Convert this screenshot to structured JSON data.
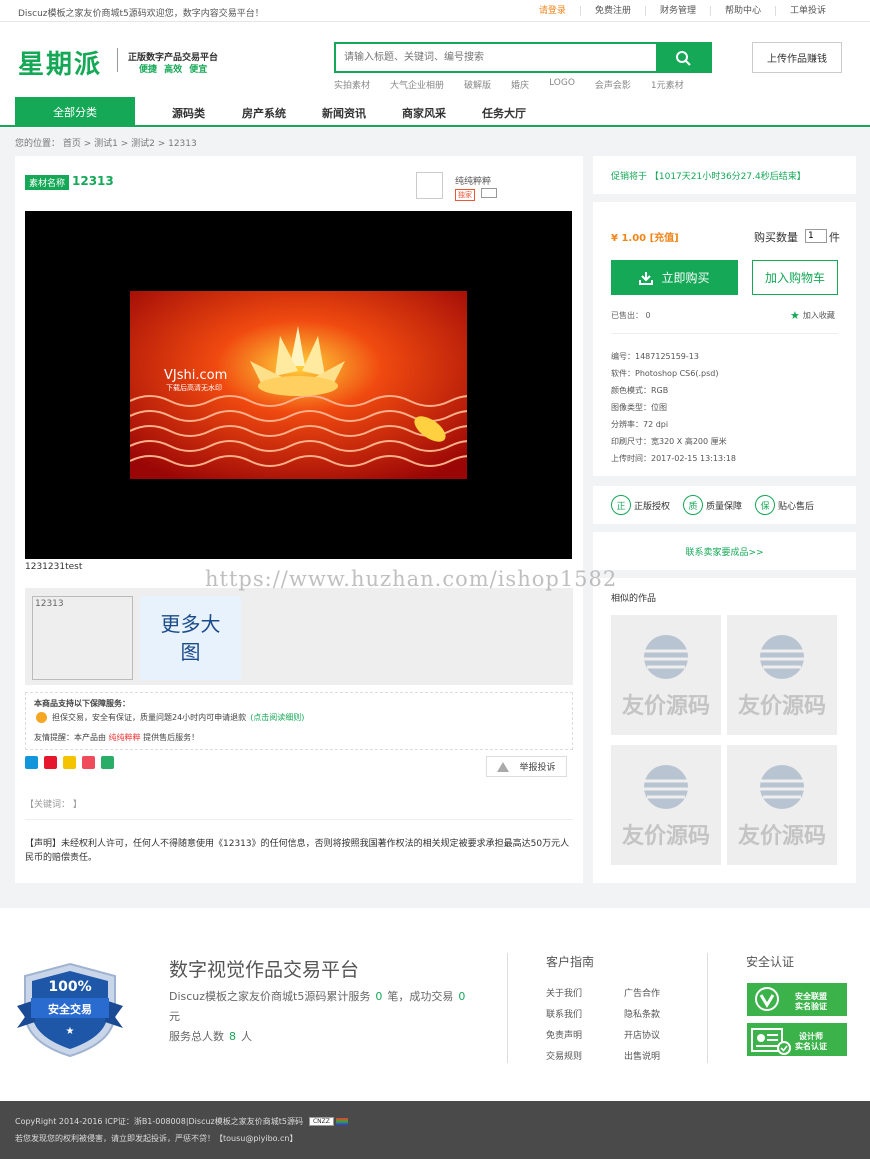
{
  "topbar": {
    "welcome": "Discuz模板之家友价商城t5源码欢迎您，数字内容交易平台！",
    "links": [
      "请登录",
      "免费注册",
      "财务管理",
      "帮助中心",
      "工单投诉"
    ]
  },
  "header": {
    "logo": "星期派",
    "slogan_main": "正版数字产品交易平台",
    "slogan_sub": "便捷 高效 便宜",
    "search_placeholder": "请输入标题、关键词、编号搜索",
    "hot_words": [
      "实拍素材",
      "大气企业相册",
      "破解版",
      "婚庆",
      "LOGO",
      "会声会影",
      "1元素材"
    ],
    "upload_label": "上传作品赚钱"
  },
  "nav": {
    "all": "全部分类",
    "items": [
      "源码类",
      "房产系统",
      "新闻资讯",
      "商家风采",
      "任务大厅"
    ]
  },
  "breadcrumb": "您的位置： 首页 > 测试1 > 测试2 > 12313",
  "product": {
    "tag": "素材名称",
    "title": "12313",
    "seller_name": "纯纯粹粹",
    "seller_badge": "独家",
    "preview_brand": "VJshi.com",
    "preview_note": "下载后高清无水印",
    "caption": "1231231test",
    "watermark": "https://www.huzhan.com/ishop1582",
    "thumb_alt": "12313",
    "more_pics": "更多大图",
    "guarantee_title": "本商品支持以下保障服务：",
    "guarantee_text": "担保交易，安全有保证，质量问题24小时内可申请退款",
    "guarantee_link": "(点击阅读细则)",
    "reminder_prefix": "友情提醒：本产品由",
    "reminder_seller": "纯纯粹粹",
    "reminder_suffix": "提供售后服务！",
    "report": "举报投诉",
    "keywords": "【关键词： 】",
    "statement": "【声明】未经权利人许可，任何人不得随意使用《12313》的任何信息，否则将按照我国著作权法的相关规定被要求承担最高达50万元人民币的赔偿责任。"
  },
  "sidebar": {
    "promo": "促销将于 【1017天21小时36分27.4秒后结束】",
    "price": "¥ 1.00 [充值]",
    "qty_label": "购买数量",
    "qty_value": "1",
    "qty_unit": "件",
    "buy": "立即购买",
    "cart": "加入购物车",
    "sold": "已售出： 0",
    "favorite": "加入收藏",
    "specs": [
      "编号：1487125159-13",
      "软件：Photoshop CS6(.psd)",
      "颜色模式：RGB",
      "图像类型：位图",
      "分辨率：72 dpi",
      "印刷尺寸：宽320 X 高200 厘米",
      "上传时间：2017-02-15 13:13:18"
    ],
    "assure": [
      {
        "icon": "正",
        "label": "正版授权"
      },
      {
        "icon": "质",
        "label": "质量保障"
      },
      {
        "icon": "保",
        "label": "贴心售后"
      }
    ],
    "contact": "联系卖家要成品>>",
    "similar_title": "相似的作品",
    "similar_placeholder": "友价源码"
  },
  "footer": {
    "shield_pct": "100%",
    "shield_text": "安全交易",
    "title": "数字视觉作品交易平台",
    "stats_a": "Discuz模板之家友价商城t5源码累计服务",
    "orders": "0",
    "stats_b": "笔，成功交易",
    "amount": "0",
    "stats_c": "元",
    "users_label": "服务总人数",
    "users": "8",
    "users_unit": "人",
    "guide_title": "客户指南",
    "guide_links": [
      "关于我们",
      "广告合作",
      "联系我们",
      "隐私条款",
      "免责声明",
      "开店协议",
      "交易规则",
      "出售说明"
    ],
    "security_title": "安全认证",
    "cert1": [
      "安全联盟",
      "实名验证"
    ],
    "cert2": [
      "设计师",
      "实名认证"
    ]
  },
  "bottom": {
    "line1": "CopyRight 2014-2016 ICP证：浙B1-008008|Discuz模板之家友价商城t5源码",
    "cnzz": "CNZZ",
    "line2": "若您发现您的权利被侵害，请立即发起投诉，严惩不贷！【tousu@piyibo.cn】"
  },
  "colors": {
    "brand": "#15a857",
    "accent": "#f08519",
    "footer_bg": "#4a4a4a"
  }
}
